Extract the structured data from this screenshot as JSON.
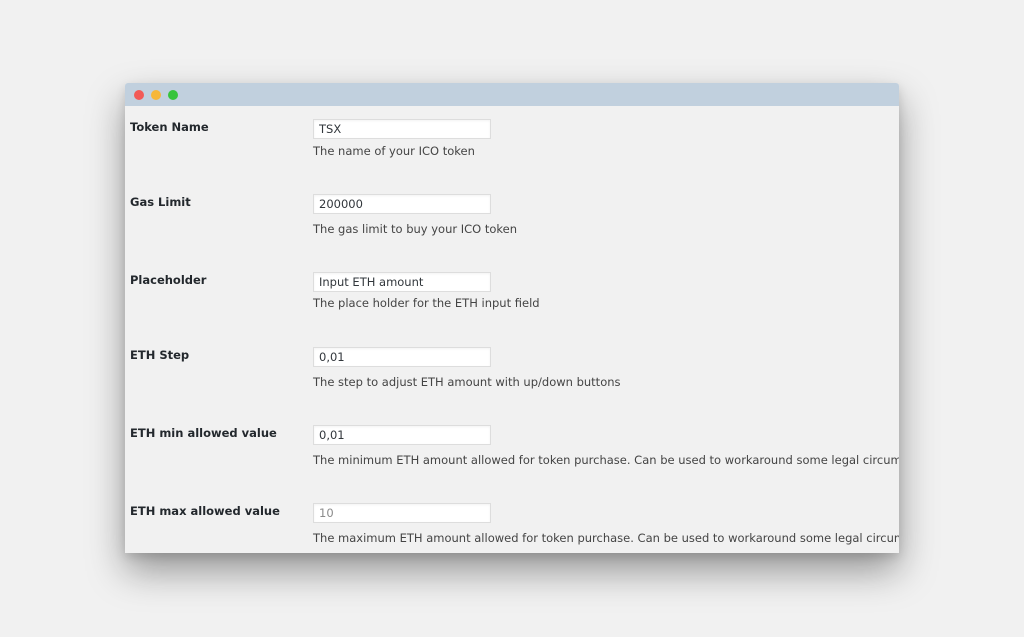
{
  "window": {
    "controls": [
      "close",
      "minimize",
      "maximize"
    ]
  },
  "settings": {
    "token_name": {
      "label": "Token Name",
      "value": "TSX",
      "description": "The name of your ICO token"
    },
    "gas_limit": {
      "label": "Gas Limit",
      "value": "200000",
      "description": "The gas limit to buy your ICO token"
    },
    "placeholder": {
      "label": "Placeholder",
      "value": "Input ETH amount",
      "description": "The place holder for the ETH input field"
    },
    "eth_step": {
      "label": "ETH Step",
      "value": "0,01",
      "description": "The step to adjust ETH amount with up/down buttons"
    },
    "eth_min": {
      "label": "ETH min allowed value",
      "value": "0,01",
      "description": "The minimum ETH amount allowed for token purchase. Can be used to workaround some legal circumstances."
    },
    "eth_max": {
      "label": "ETH max allowed value",
      "value": "10",
      "description": "The maximum ETH amount allowed for token purchase. Can be used to workaround some legal circumstances."
    }
  },
  "colors": {
    "titlebar": "#c1d0de",
    "close": "#f25a57",
    "minimize": "#f6b73a",
    "maximize": "#36c43b"
  }
}
